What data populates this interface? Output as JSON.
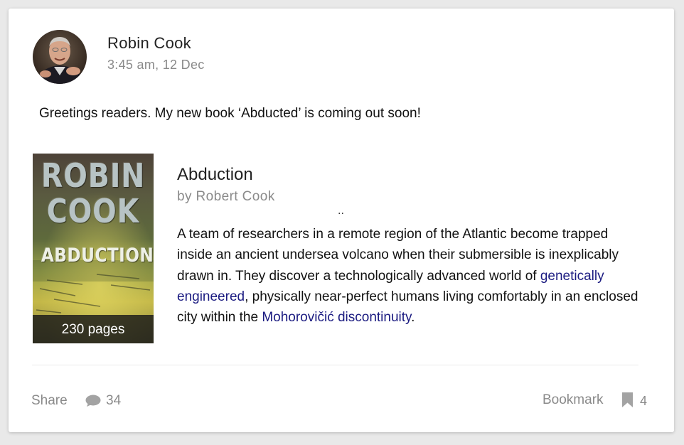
{
  "post": {
    "author_name": "Robin Cook",
    "timestamp": "3:45 am, 12 Dec",
    "text": "Greetings readers. My new book ‘Abducted’ is coming out soon!"
  },
  "book": {
    "cover": {
      "author_line1": "ROBIN",
      "author_line2": "COOK",
      "title": "ABDUCTION",
      "pages_badge": "230 pages"
    },
    "title": "Abduction",
    "byline": "by Robert Cook",
    "dots": "..",
    "description": {
      "part1": "A team of researchers in a remote region of the Atlantic become trapped inside an ancient undersea volcano when their submersible is inexplicably drawn in. They discover a technologically advanced world of ",
      "link1": "genetically engineered",
      "part2": ", physically near-perfect humans living comfortably in an enclosed city within the ",
      "link2": "Mohorovičić discontinuity",
      "part3": "."
    }
  },
  "footer": {
    "share_label": "Share",
    "comment_icon": "speech-bubble-icon",
    "comment_count": "34",
    "bookmark_label": "Bookmark",
    "bookmark_icon": "bookmark-icon",
    "bookmark_count": "4"
  },
  "colors": {
    "link": "#1a1a80",
    "muted": "#8a8a8a",
    "text": "#111111",
    "background": "#e9e9e9",
    "card": "#ffffff"
  }
}
